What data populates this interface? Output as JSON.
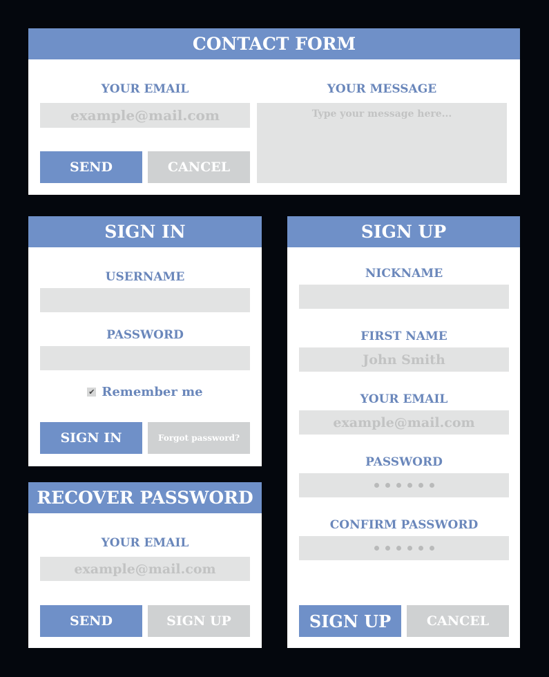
{
  "contact": {
    "title": "CONTACT FORM",
    "email_label": "YOUR EMAIL",
    "email_placeholder": "example@mail.com",
    "message_label": "YOUR MESSAGE",
    "message_placeholder": "Type your message here...",
    "send_label": "SEND",
    "cancel_label": "CANCEL"
  },
  "signin": {
    "title": "SIGN IN",
    "username_label": "USERNAME",
    "password_label": "PASSWORD",
    "remember_label": "Remember me",
    "remember_checked": true,
    "signin_label": "SIGN IN",
    "forgot_label": "Forgot password?"
  },
  "recover": {
    "title": "RECOVER PASSWORD",
    "email_label": "YOUR EMAIL",
    "email_placeholder": "example@mail.com",
    "send_label": "SEND",
    "signup_label": "SIGN UP"
  },
  "signup": {
    "title": "SIGN UP",
    "nickname_label": "NICKNAME",
    "firstname_label": "FIRST NAME",
    "firstname_placeholder": "John Smith",
    "email_label": "YOUR EMAIL",
    "email_placeholder": "example@mail.com",
    "password_label": "PASSWORD",
    "password_mask_count": 6,
    "confirm_label": "CONFIRM PASSWORD",
    "confirm_mask_count": 6,
    "signup_label": "SIGN UP",
    "cancel_label": "CANCEL"
  },
  "colors": {
    "background": "#04070d",
    "accent": "#6f90c8",
    "label": "#6a87bb",
    "input_bg": "#e2e3e3",
    "secondary_button": "#cfd1d2"
  }
}
